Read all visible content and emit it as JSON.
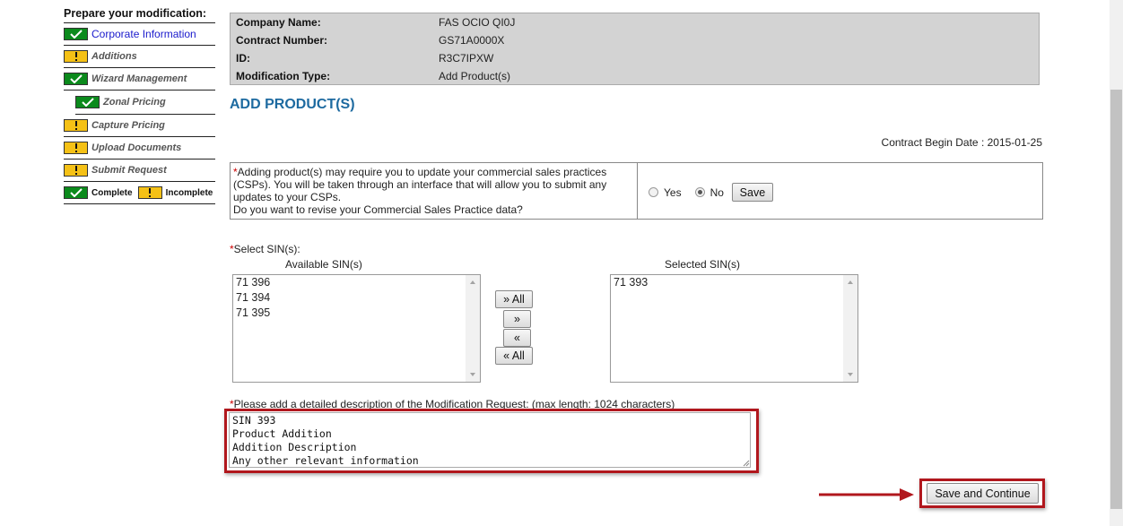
{
  "sidebar": {
    "title": "Prepare your modification:",
    "items": [
      {
        "label": "Corporate Information",
        "status": "complete",
        "link": true
      },
      {
        "label": "Additions",
        "status": "incomplete"
      },
      {
        "label": "Wizard Management",
        "status": "complete"
      },
      {
        "label": "Zonal Pricing",
        "status": "complete",
        "sub": true
      },
      {
        "label": "Capture Pricing",
        "status": "incomplete"
      },
      {
        "label": "Upload Documents",
        "status": "incomplete"
      },
      {
        "label": "Submit Request",
        "status": "incomplete"
      }
    ],
    "legend": {
      "complete": "Complete",
      "incomplete": "Incomplete"
    }
  },
  "info": {
    "company_label": "Company Name:",
    "company_value": "FAS OCIO QI0J",
    "contract_label": "Contract Number:",
    "contract_value": "GS71A0000X",
    "id_label": "ID:",
    "id_value": "R3C7IPXW",
    "mod_label": "Modification Type:",
    "mod_value": "Add Product(s)"
  },
  "page_title": "ADD PRODUCT(S)",
  "contract_begin": "Contract Begin Date : 2015-01-25",
  "csp": {
    "asterisk": "*",
    "text_line1": "Adding product(s) may require you to update your commercial sales practices",
    "text_line2": "(CSPs). You will be taken through an interface that will allow you to submit any",
    "text_line3": "updates to your CSPs.",
    "text_line4": "Do you want to revise your Commercial Sales Practice data?",
    "yes_label": "Yes",
    "no_label": "No",
    "selected": "No",
    "save_label": "Save"
  },
  "sin": {
    "asterisk": "*",
    "label": "Select SIN(s):",
    "available_heading": "Available SIN(s)",
    "selected_heading": "Selected SIN(s)",
    "available": [
      "71 396",
      "71 394",
      "71 395"
    ],
    "selected": [
      "71 393"
    ],
    "move_all_right": "» All",
    "move_right": "»",
    "move_left": "«",
    "move_all_left": "« All"
  },
  "description": {
    "asterisk": "*",
    "label": "Please add a detailed description of the Modification Request: (max length: 1024 characters)",
    "value": "SIN 393\nProduct Addition\nAddition Description\nAny other relevant information"
  },
  "save_continue_label": "Save and Continue",
  "colors": {
    "highlight": "#b1171d",
    "title": "#1d6aa0",
    "complete": "#0b8a1c",
    "incomplete": "#f5c116"
  }
}
